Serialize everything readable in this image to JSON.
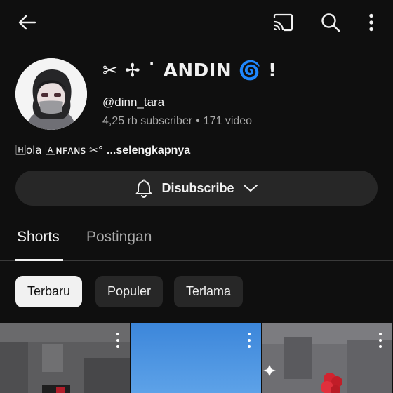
{
  "header": {
    "back_icon": "arrow-left-icon",
    "cast_icon": "cast-icon",
    "search_icon": "search-icon",
    "more_icon": "more-vert-icon"
  },
  "channel": {
    "name_prefix": "✂ ✢ ˙",
    "name": "ANDIN",
    "name_suffix": "🌀 !",
    "handle": "@dinn_tara",
    "subscribers": "4,25 rb subscriber",
    "separator": "•",
    "videos": "171 video",
    "description": "🄷ola 🄰ɴꜰᴀɴꜱ ✂°",
    "description_more": "...selengkapnya"
  },
  "subscribe_button": {
    "label": "Disubscribe",
    "bell_icon": "bell-icon",
    "chevron_icon": "chevron-down-icon"
  },
  "tabs": [
    {
      "label": "Shorts",
      "active": true
    },
    {
      "label": "Postingan",
      "active": false
    }
  ],
  "filters": [
    {
      "label": "Terbaru",
      "selected": true
    },
    {
      "label": "Populer",
      "selected": false
    },
    {
      "label": "Terlama",
      "selected": false
    }
  ],
  "colors": {
    "background": "#0f0f0f",
    "surface": "#272727",
    "text_primary": "#f1f1f1",
    "text_secondary": "#aaaaaa",
    "thumb_sky": "#3f88d8"
  }
}
